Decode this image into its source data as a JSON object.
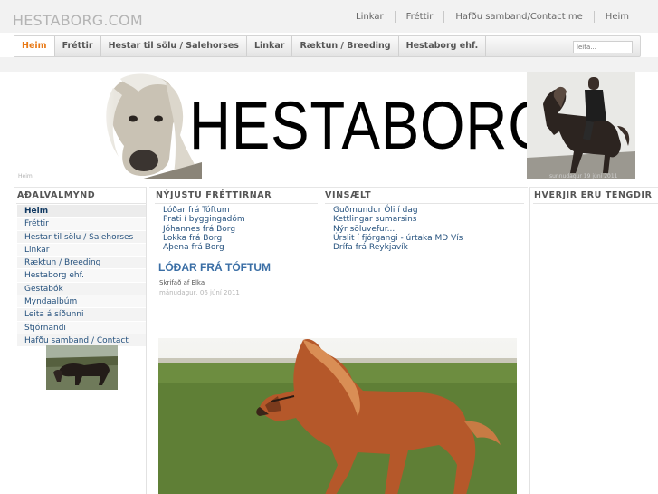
{
  "site": {
    "logo_text": "HESTABORG.COM"
  },
  "top_links": [
    "Linkar",
    "Fréttir",
    "Hafðu samband/Contact me",
    "Heim"
  ],
  "nav": {
    "tabs": [
      "Heim",
      "Fréttir",
      "Hestar til sölu / Salehorses",
      "Linkar",
      "Ræktun / Breeding",
      "Hestaborg ehf."
    ],
    "active_tab": "Heim",
    "search_placeholder": "leita..."
  },
  "banner": {
    "title": "HESTABORG",
    "caption_left": "Heim",
    "caption_right": "sunnudagur 19 júní 2011"
  },
  "left": {
    "heading": "AÐALVALMYND",
    "menu": [
      "Heim",
      "Fréttir",
      "Hestar til sölu / Salehorses",
      "Linkar",
      "Ræktun / Breeding",
      "Hestaborg ehf.",
      "Gestabók",
      "Myndaalbúm",
      "Leita á síðunni",
      "Stjórnandi",
      "Hafðu samband / Contact"
    ]
  },
  "news": {
    "heading": "NÝJUSTU FRÉTTIRNAR",
    "items": [
      "Lóðar frá Tóftum",
      "Prati í byggingadóm",
      "Jóhannes frá Borg",
      "Lokka frá Borg",
      "Aþena frá Borg"
    ]
  },
  "popular": {
    "heading": "VINSÆLT",
    "items": [
      "Guðmundur Óli í dag",
      "Kettlingar sumarsins",
      "Nýr söluvefur...",
      "Úrslit í fjórgangi - úrtaka MD Vís",
      "Drífa frá Reykjavík"
    ]
  },
  "article": {
    "title": "LÓÐAR FRÁ TÓFTUM",
    "author": "Skrifað af Elka",
    "date": "mánudagur, 06 júní 2011"
  },
  "right": {
    "heading": "HVERJIR ERU TENGDIR"
  },
  "colors": {
    "accent": "#e87a17",
    "link": "#26527e",
    "title_blue": "#3a6ea5"
  }
}
